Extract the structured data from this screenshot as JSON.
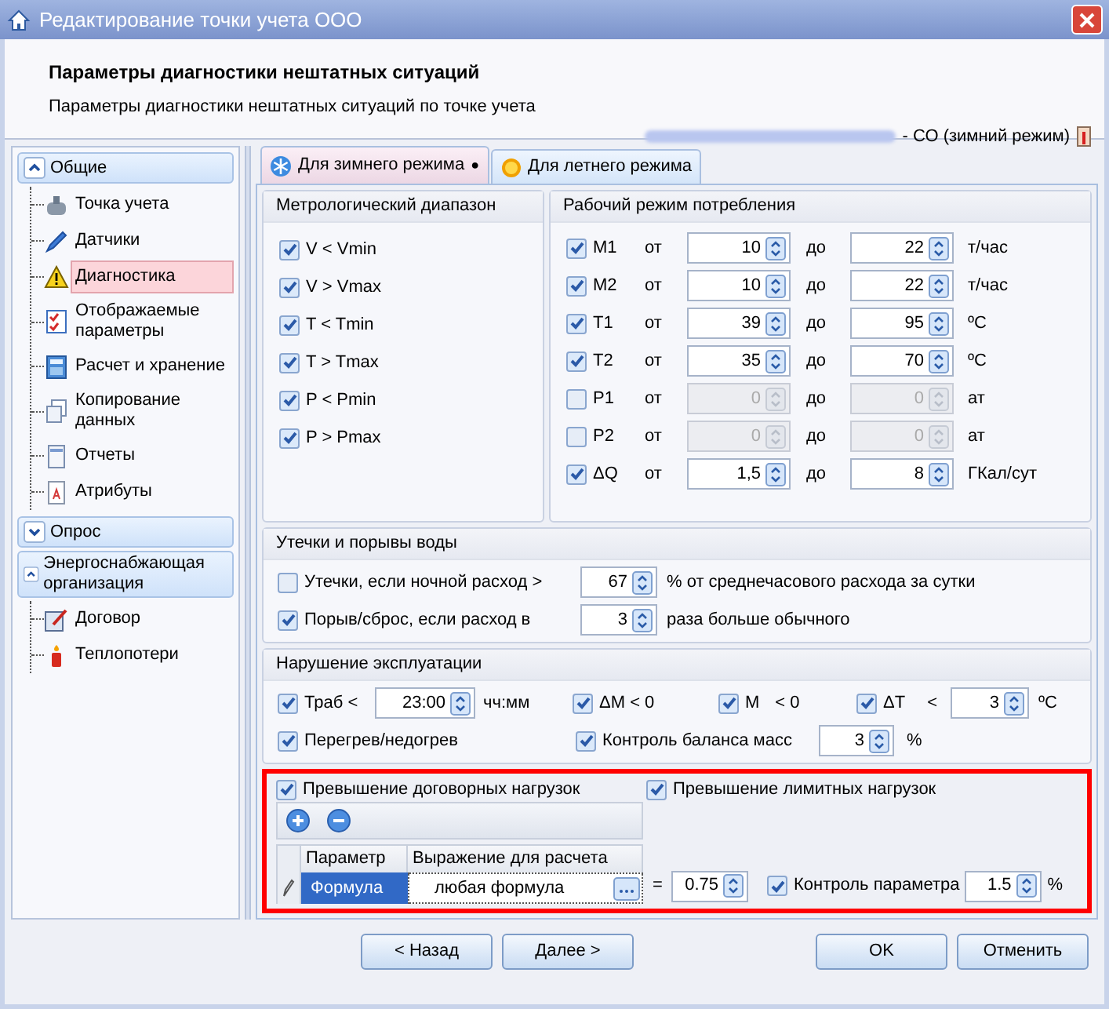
{
  "window": {
    "title": "Редактирование точки учета ООО"
  },
  "header": {
    "title": "Параметры диагностики нештатных ситуаций",
    "subtitle": "Параметры диагностики нештатных ситуаций по точке учета",
    "mode": "- СО (зимний режим)"
  },
  "sidebar": {
    "groups": [
      {
        "label": "Общие",
        "expanded": true,
        "items": [
          {
            "label": "Точка учета",
            "selected": false
          },
          {
            "label": "Датчики",
            "selected": false
          },
          {
            "label": "Диагностика",
            "selected": true
          },
          {
            "label": "Отображаемые параметры",
            "selected": false
          },
          {
            "label": "Расчет и хранение",
            "selected": false
          },
          {
            "label": "Копирование данных",
            "selected": false
          },
          {
            "label": "Отчеты",
            "selected": false
          },
          {
            "label": "Атрибуты",
            "selected": false
          }
        ]
      },
      {
        "label": "Опрос",
        "expanded": false
      },
      {
        "label": "Энергоснабжающая организация",
        "expanded": true,
        "items": [
          {
            "label": "Договор",
            "selected": false
          },
          {
            "label": "Теплопотери",
            "selected": false
          }
        ]
      }
    ]
  },
  "tabs": [
    {
      "label": "Для зимнего режима",
      "kind": "winter",
      "selected": true,
      "badge": "●"
    },
    {
      "label": "Для летнего режима",
      "kind": "summer",
      "selected": false
    }
  ],
  "metrology": {
    "title": "Метрологический диапазон",
    "items": [
      {
        "label": "V < Vmin",
        "checked": true
      },
      {
        "label": "V > Vmax",
        "checked": true
      },
      {
        "label": "T < Tmin",
        "checked": true
      },
      {
        "label": "T > Tmax",
        "checked": true
      },
      {
        "label": "P < Pmin",
        "checked": true
      },
      {
        "label": "P > Pmax",
        "checked": true
      }
    ]
  },
  "consumption": {
    "title": "Рабочий режим потребления",
    "rows": [
      {
        "label": "M1",
        "checked": true,
        "from_label": "от",
        "from": "10",
        "to_label": "до",
        "to": "22",
        "unit": "т/час"
      },
      {
        "label": "M2",
        "checked": true,
        "from_label": "от",
        "from": "10",
        "to_label": "до",
        "to": "22",
        "unit": "т/час"
      },
      {
        "label": "T1",
        "checked": true,
        "from_label": "от",
        "from": "39",
        "to_label": "до",
        "to": "95",
        "unit": "ºC"
      },
      {
        "label": "T2",
        "checked": true,
        "from_label": "от",
        "from": "35",
        "to_label": "до",
        "to": "70",
        "unit": "ºC"
      },
      {
        "label": "P1",
        "checked": false,
        "from_label": "от",
        "from": "0",
        "to_label": "до",
        "to": "0",
        "unit": "ат"
      },
      {
        "label": "P2",
        "checked": false,
        "from_label": "от",
        "from": "0",
        "to_label": "до",
        "to": "0",
        "unit": "ат"
      },
      {
        "label": "ΔQ",
        "checked": true,
        "from_label": "от",
        "from": "1,5",
        "to_label": "до",
        "to": "8",
        "unit": "ГКал/сут"
      }
    ]
  },
  "leaks": {
    "title": "Утечки и порывы воды",
    "rows": [
      {
        "label": "Утечки, если ночной расход >",
        "checked": false,
        "value": "67",
        "suffix": "% от среднечасового расхода за сутки"
      },
      {
        "label": "Порыв/сброс, если расход в",
        "checked": true,
        "value": "3",
        "suffix": "раза больше обычного"
      }
    ]
  },
  "operation": {
    "title": "Нарушение эксплуатации",
    "trab": {
      "label": "Траб <",
      "checked": true,
      "value": "23:00",
      "unit": "чч:мм"
    },
    "dm": {
      "label": "ΔM < 0",
      "checked": true
    },
    "m": {
      "label": "M",
      "op": "< 0",
      "checked": true
    },
    "dt": {
      "label": "ΔT",
      "op": "<",
      "checked": true,
      "value": "3",
      "unit": "ºC"
    },
    "overheat": {
      "label": "Перегрев/недогрев",
      "checked": true
    },
    "balance": {
      "label": "Контроль баланса масс",
      "checked": true,
      "value": "3",
      "unit": "%"
    }
  },
  "loads": {
    "contract": {
      "label": "Превышение договорных нагрузок",
      "checked": true
    },
    "limit": {
      "label": "Превышение лимитных нагрузок",
      "checked": true
    },
    "table": {
      "columns": [
        "Параметр",
        "Выражение для расчета"
      ],
      "rows": [
        {
          "parameter": "Формула",
          "expression": "любая формула",
          "selected": true
        }
      ]
    },
    "equals": "=",
    "value": "0.75",
    "control": {
      "label": "Контроль параметра",
      "checked": true,
      "value": "1.5",
      "unit": "%"
    }
  },
  "buttons": [
    {
      "label": "< Назад"
    },
    {
      "label": "Далее >"
    },
    {
      "label": "OK"
    },
    {
      "label": "Отменить"
    }
  ]
}
